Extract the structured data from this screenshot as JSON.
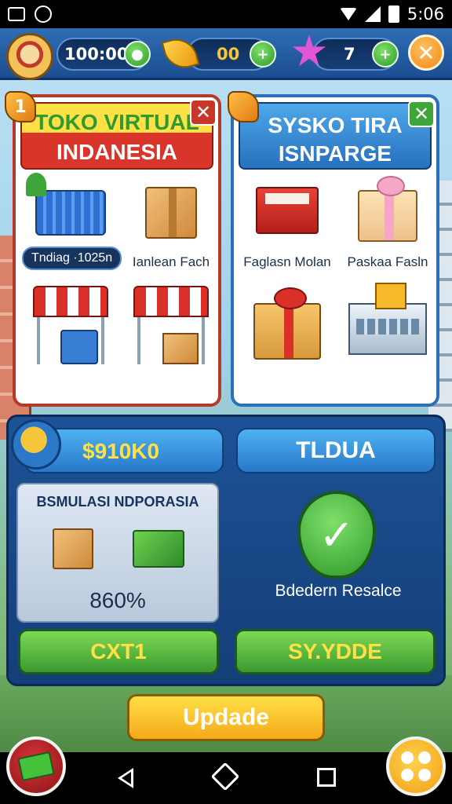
{
  "status_bar": {
    "time": "5:06"
  },
  "resources": {
    "timer": "100:00",
    "gold": "00",
    "gems": "7"
  },
  "shop_left": {
    "badge": "1",
    "title_line1": "TOKO VIRTUAL",
    "title_line2": "INDANESIA",
    "items": [
      {
        "label": "Tndiag ·1025n",
        "icon": "basket-icon"
      },
      {
        "label": "Ianlean Fach",
        "icon": "box-icon"
      },
      {
        "label": "",
        "icon": "stall-cart-icon"
      },
      {
        "label": "",
        "icon": "stall-box-icon"
      }
    ]
  },
  "shop_right": {
    "title_line1": "SYSKO TIRA",
    "title_line2": "ISNPARGE",
    "items": [
      {
        "label": "Faglasn Molan",
        "icon": "red-gift-icon"
      },
      {
        "label": "Paskaa Fasln",
        "icon": "pink-gift-icon"
      },
      {
        "label": "",
        "icon": "gold-gift-icon"
      },
      {
        "label": "",
        "icon": "shop-building-icon"
      }
    ]
  },
  "bottom": {
    "money": "$910K0",
    "tab_label": "TLDUA",
    "sim_title": "BSMULASI NDPORASIA",
    "sim_percent": "860%",
    "status_text": "Bdedern Resalce",
    "btn_left": "CXT1",
    "btn_right": "SY.YDDE"
  },
  "update_label": "Updade",
  "colors": {
    "panel_blue": "#1d5296",
    "accent_green": "#3a9a2e",
    "accent_yellow": "#ffe046",
    "accent_red": "#d9352a"
  }
}
